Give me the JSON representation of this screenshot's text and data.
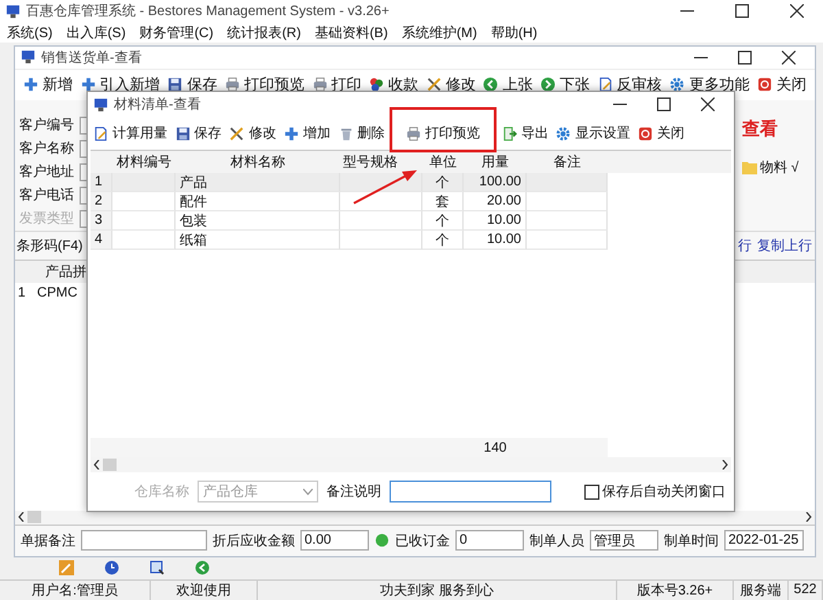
{
  "window": {
    "title": "百惠仓库管理系统 - Bestores Management System - v3.26+"
  },
  "menu": [
    "系统(S)",
    "出入库(S)",
    "财务管理(C)",
    "统计报表(R)",
    "基础资料(B)",
    "系统维护(M)",
    "帮助(H)"
  ],
  "document": {
    "title": "销售送货单-查看",
    "toolbar": [
      {
        "label": "新增",
        "kind": "plus"
      },
      {
        "label": "引入新增",
        "kind": "plus"
      },
      {
        "label": "保存",
        "kind": "save"
      },
      {
        "label": "打印预览",
        "kind": "printer"
      },
      {
        "label": "打印",
        "kind": "printer"
      },
      {
        "label": "收款",
        "kind": "coins"
      },
      {
        "label": "修改",
        "kind": "tools"
      },
      {
        "label": "上张",
        "kind": "back"
      },
      {
        "label": "下张",
        "kind": "forward"
      },
      {
        "label": "反审核",
        "kind": "docedit"
      },
      {
        "label": "更多功能",
        "kind": "gear"
      },
      {
        "label": "关闭",
        "kind": "close"
      }
    ],
    "fields": [
      {
        "label": "客户编号",
        "disabled": false
      },
      {
        "label": "客户名称",
        "disabled": false
      },
      {
        "label": "客户地址",
        "disabled": false
      },
      {
        "label": "客户电话",
        "disabled": false
      },
      {
        "label": "发票类型",
        "disabled": true
      }
    ],
    "stamp": "查看",
    "side_item": "物料 √",
    "barcode_label": "条形码(F4)",
    "links": [
      "行",
      "复制上行"
    ],
    "table": {
      "columns": [
        "产品拼"
      ],
      "rows": [
        {
          "num": "1",
          "cells": [
            "CPMC"
          ]
        }
      ]
    },
    "footer": [
      {
        "label": "单据备注",
        "kind": "plain"
      },
      {
        "label": "折后应收金额",
        "value": "0.00",
        "kind": "plain"
      },
      {
        "label": "已收订金",
        "value": "0",
        "kind": "status"
      },
      {
        "label": "制单人员",
        "value": "管理员",
        "kind": "plain"
      },
      {
        "label": "制单时间",
        "value": "2022-01-25",
        "kind": "plain"
      }
    ]
  },
  "dialog": {
    "title": "材料清单-查看",
    "toolbar": [
      {
        "label": "计算用量",
        "kind": "docedit"
      },
      {
        "label": "保存",
        "kind": "save"
      },
      {
        "label": "修改",
        "kind": "tools"
      },
      {
        "label": "增加",
        "kind": "plus"
      },
      {
        "label": "删除",
        "kind": "trash"
      },
      {
        "label": "打印预览",
        "kind": "printer",
        "highlighted": true
      },
      {
        "label": "导出",
        "kind": "export"
      },
      {
        "label": "显示设置",
        "kind": "gear"
      },
      {
        "label": "关闭",
        "kind": "close"
      }
    ],
    "table": {
      "columns": [
        "材料编号",
        "材料名称",
        "型号规格",
        "单位",
        "用量",
        "备注"
      ],
      "rows": [
        {
          "num": "1",
          "name": "产品",
          "unit": "个",
          "qty": "100.00",
          "selected": true
        },
        {
          "num": "2",
          "name": "配件",
          "unit": "套",
          "qty": "20.00",
          "selected": false
        },
        {
          "num": "3",
          "name": "包装",
          "unit": "个",
          "qty": "10.00",
          "selected": false
        },
        {
          "num": "4",
          "name": "纸箱",
          "unit": "个",
          "qty": "10.00",
          "selected": false
        }
      ],
      "total": "140"
    },
    "warehouse": {
      "label": "仓库名称",
      "value": "产品仓库",
      "disabled": true
    },
    "note": {
      "label": "备注说明"
    },
    "auto_close": {
      "label": "保存后自动关闭窗口",
      "checked": false
    }
  },
  "status_bar": [
    "用户名:管理员",
    "欢迎使用",
    "功夫到家 服务到心",
    "版本号3.26+",
    "服务端",
    "522"
  ]
}
